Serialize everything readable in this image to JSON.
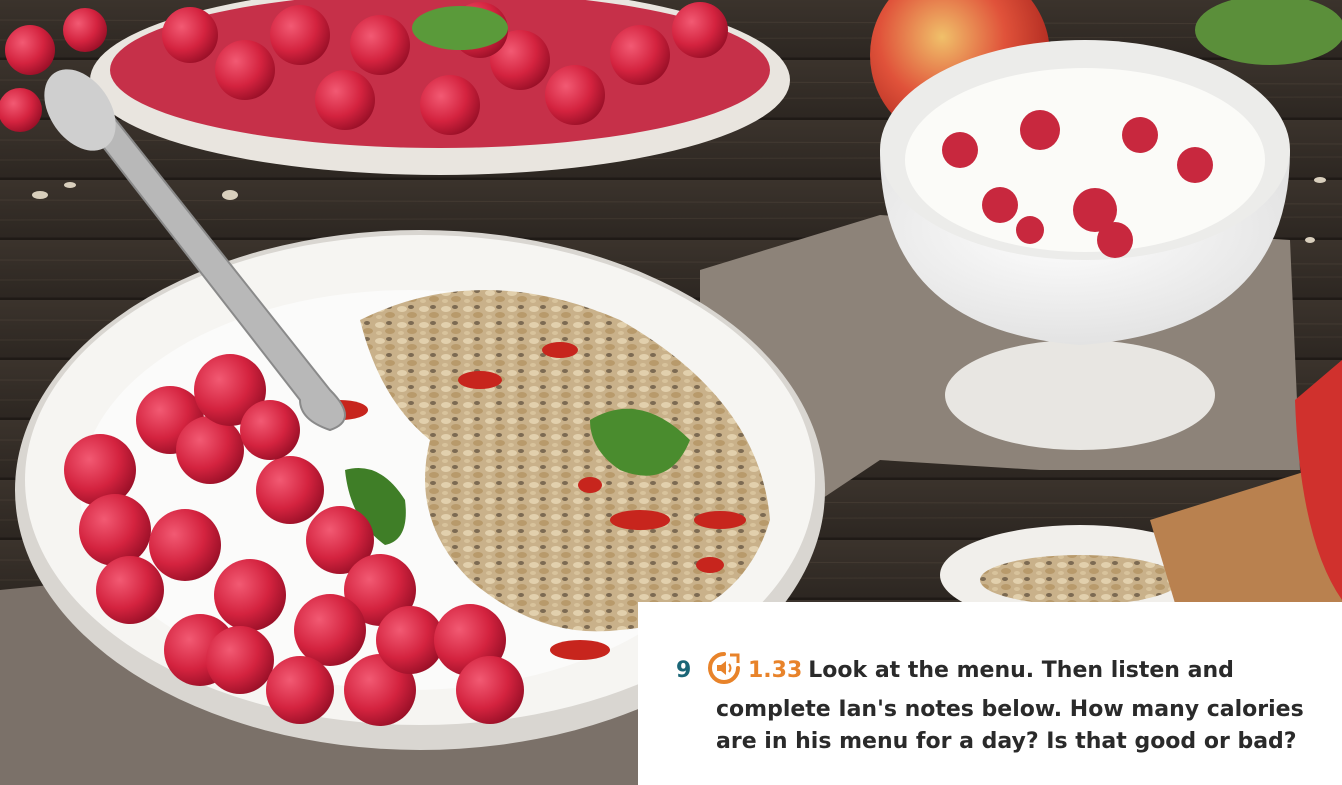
{
  "exercise": {
    "number": "9",
    "track": "1.33",
    "line1": "Look at the menu. Then listen and",
    "line2": "complete Ian's notes below. How many calories",
    "line3": "are in his menu for a day? Is that good or bad?",
    "audio_icon": "audio-speaker-icon"
  },
  "colors": {
    "exercise_number": "#1a6677",
    "track_accent": "#e8832a",
    "text": "#2a2a2a"
  }
}
